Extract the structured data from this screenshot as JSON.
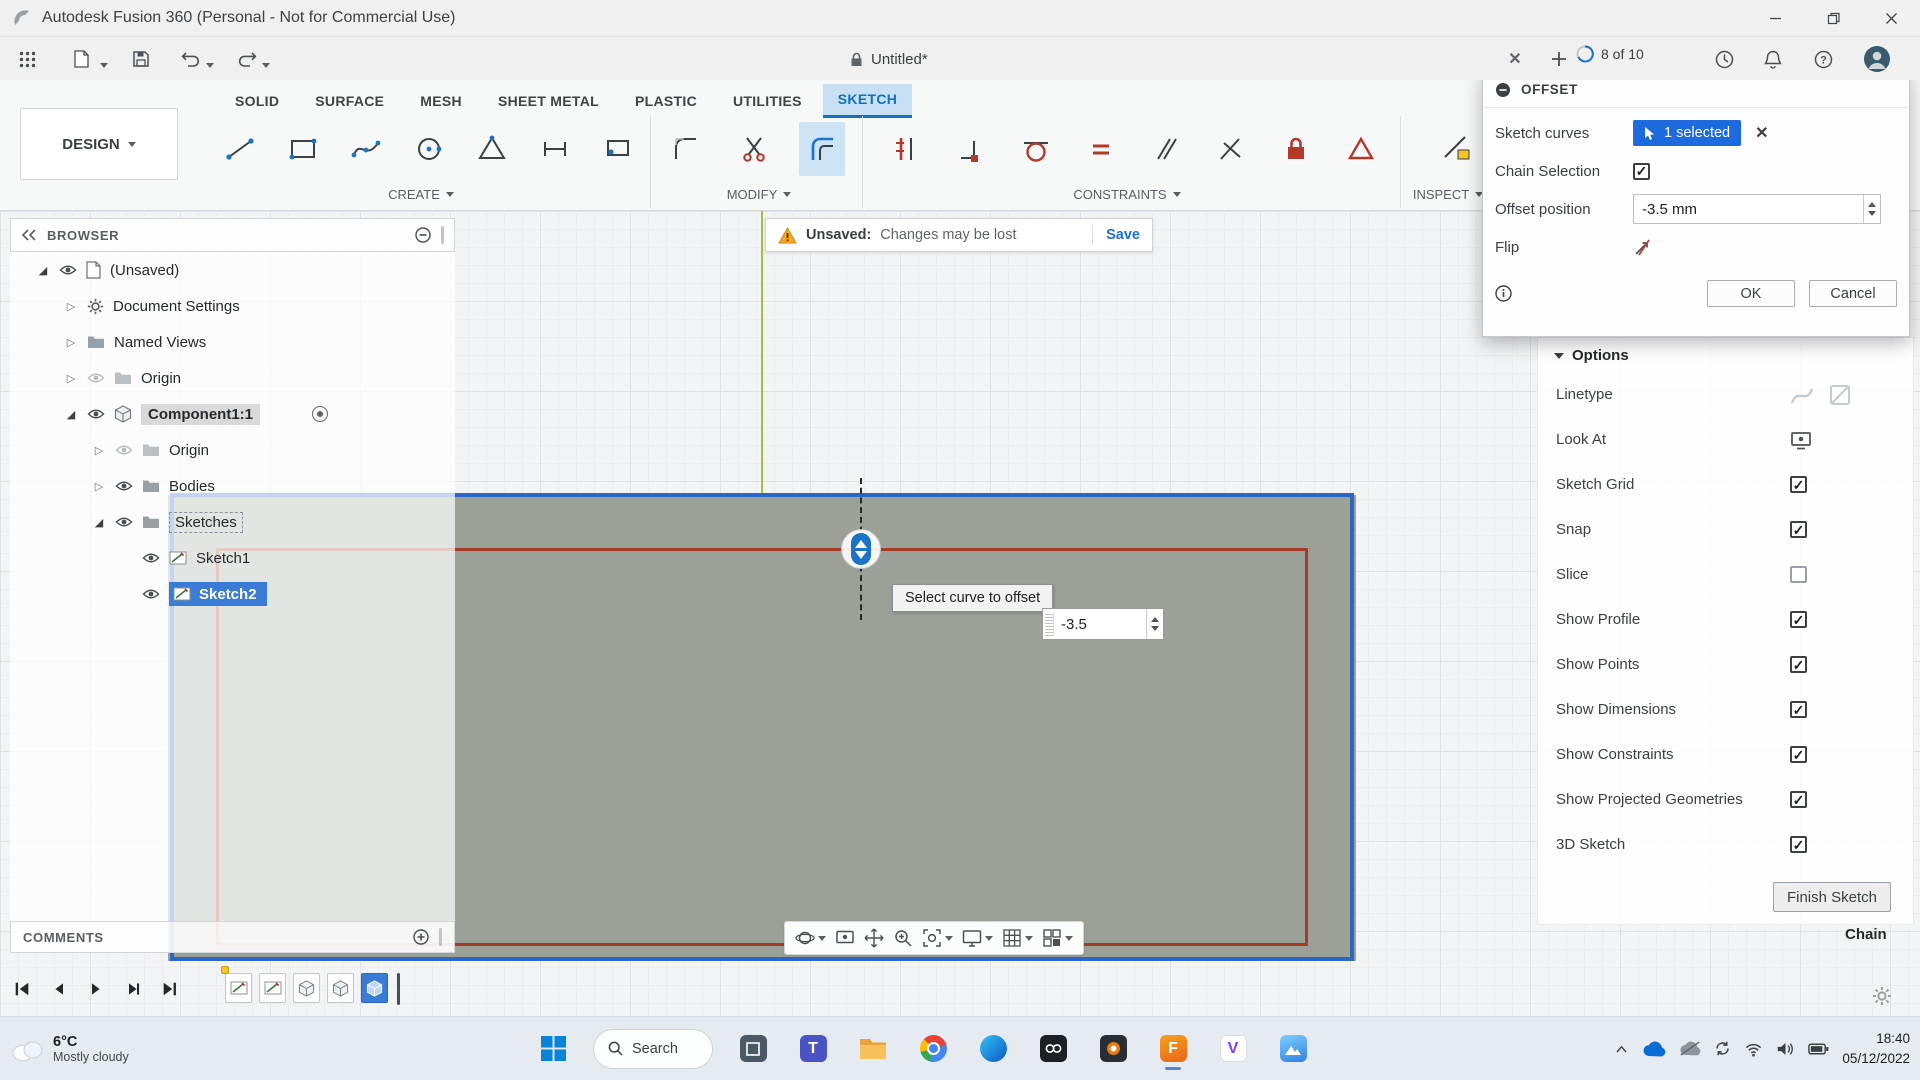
{
  "window": {
    "title": "Autodesk Fusion 360 (Personal - Not for Commercial Use)"
  },
  "qat": {
    "doc_title": "Untitled*",
    "quota": "8 of 10"
  },
  "ribbon": {
    "design": "DESIGN",
    "tabs": [
      "SOLID",
      "SURFACE",
      "MESH",
      "SHEET METAL",
      "PLASTIC",
      "UTILITIES",
      "SKETCH"
    ],
    "group_create": "CREATE",
    "group_modify": "MODIFY",
    "group_constraints": "CONSTRAINTS",
    "group_inspect": "INSPECT"
  },
  "warning": {
    "label": "Unsaved:",
    "message": "Changes may be lost",
    "action": "Save"
  },
  "browser": {
    "title": "BROWSER",
    "items": [
      {
        "label": "(Unsaved)"
      },
      {
        "label": "Document Settings"
      },
      {
        "label": "Named Views"
      },
      {
        "label": "Origin"
      },
      {
        "label": "Component1:1"
      },
      {
        "label": "Origin"
      },
      {
        "label": "Bodies"
      },
      {
        "label": "Sketches"
      },
      {
        "label": "Sketch1"
      },
      {
        "label": "Sketch2"
      }
    ]
  },
  "dialog": {
    "title": "OFFSET",
    "sketch_curves_label": "Sketch curves",
    "selected_badge": "1 selected",
    "chain_selection_label": "Chain Selection",
    "chain_selection_checked": true,
    "offset_position_label": "Offset position",
    "offset_value": "-3.5 mm",
    "flip_label": "Flip",
    "ok": "OK",
    "cancel": "Cancel"
  },
  "options": {
    "title": "Options",
    "items": [
      {
        "label": "Linetype"
      },
      {
        "label": "Look At"
      },
      {
        "label": "Sketch Grid",
        "checked": true
      },
      {
        "label": "Snap",
        "checked": true
      },
      {
        "label": "Slice",
        "checked": false
      },
      {
        "label": "Show Profile",
        "checked": true
      },
      {
        "label": "Show Points",
        "checked": true
      },
      {
        "label": "Show Dimensions",
        "checked": true
      },
      {
        "label": "Show Constraints",
        "checked": true
      },
      {
        "label": "Show Projected Geometries",
        "checked": true
      },
      {
        "label": "3D Sketch",
        "checked": true
      }
    ],
    "finish_button": "Finish Sketch"
  },
  "canvas": {
    "tooltip": "Select curve to offset",
    "offset_input": "-3.5"
  },
  "comments": {
    "title": "COMMENTS"
  },
  "status": {
    "mode": "Chain"
  },
  "taskbar": {
    "weather_temp": "6°C",
    "weather_condition": "Mostly cloudy",
    "search_placeholder": "Search",
    "time": "18:40",
    "date": "05/12/2022"
  }
}
